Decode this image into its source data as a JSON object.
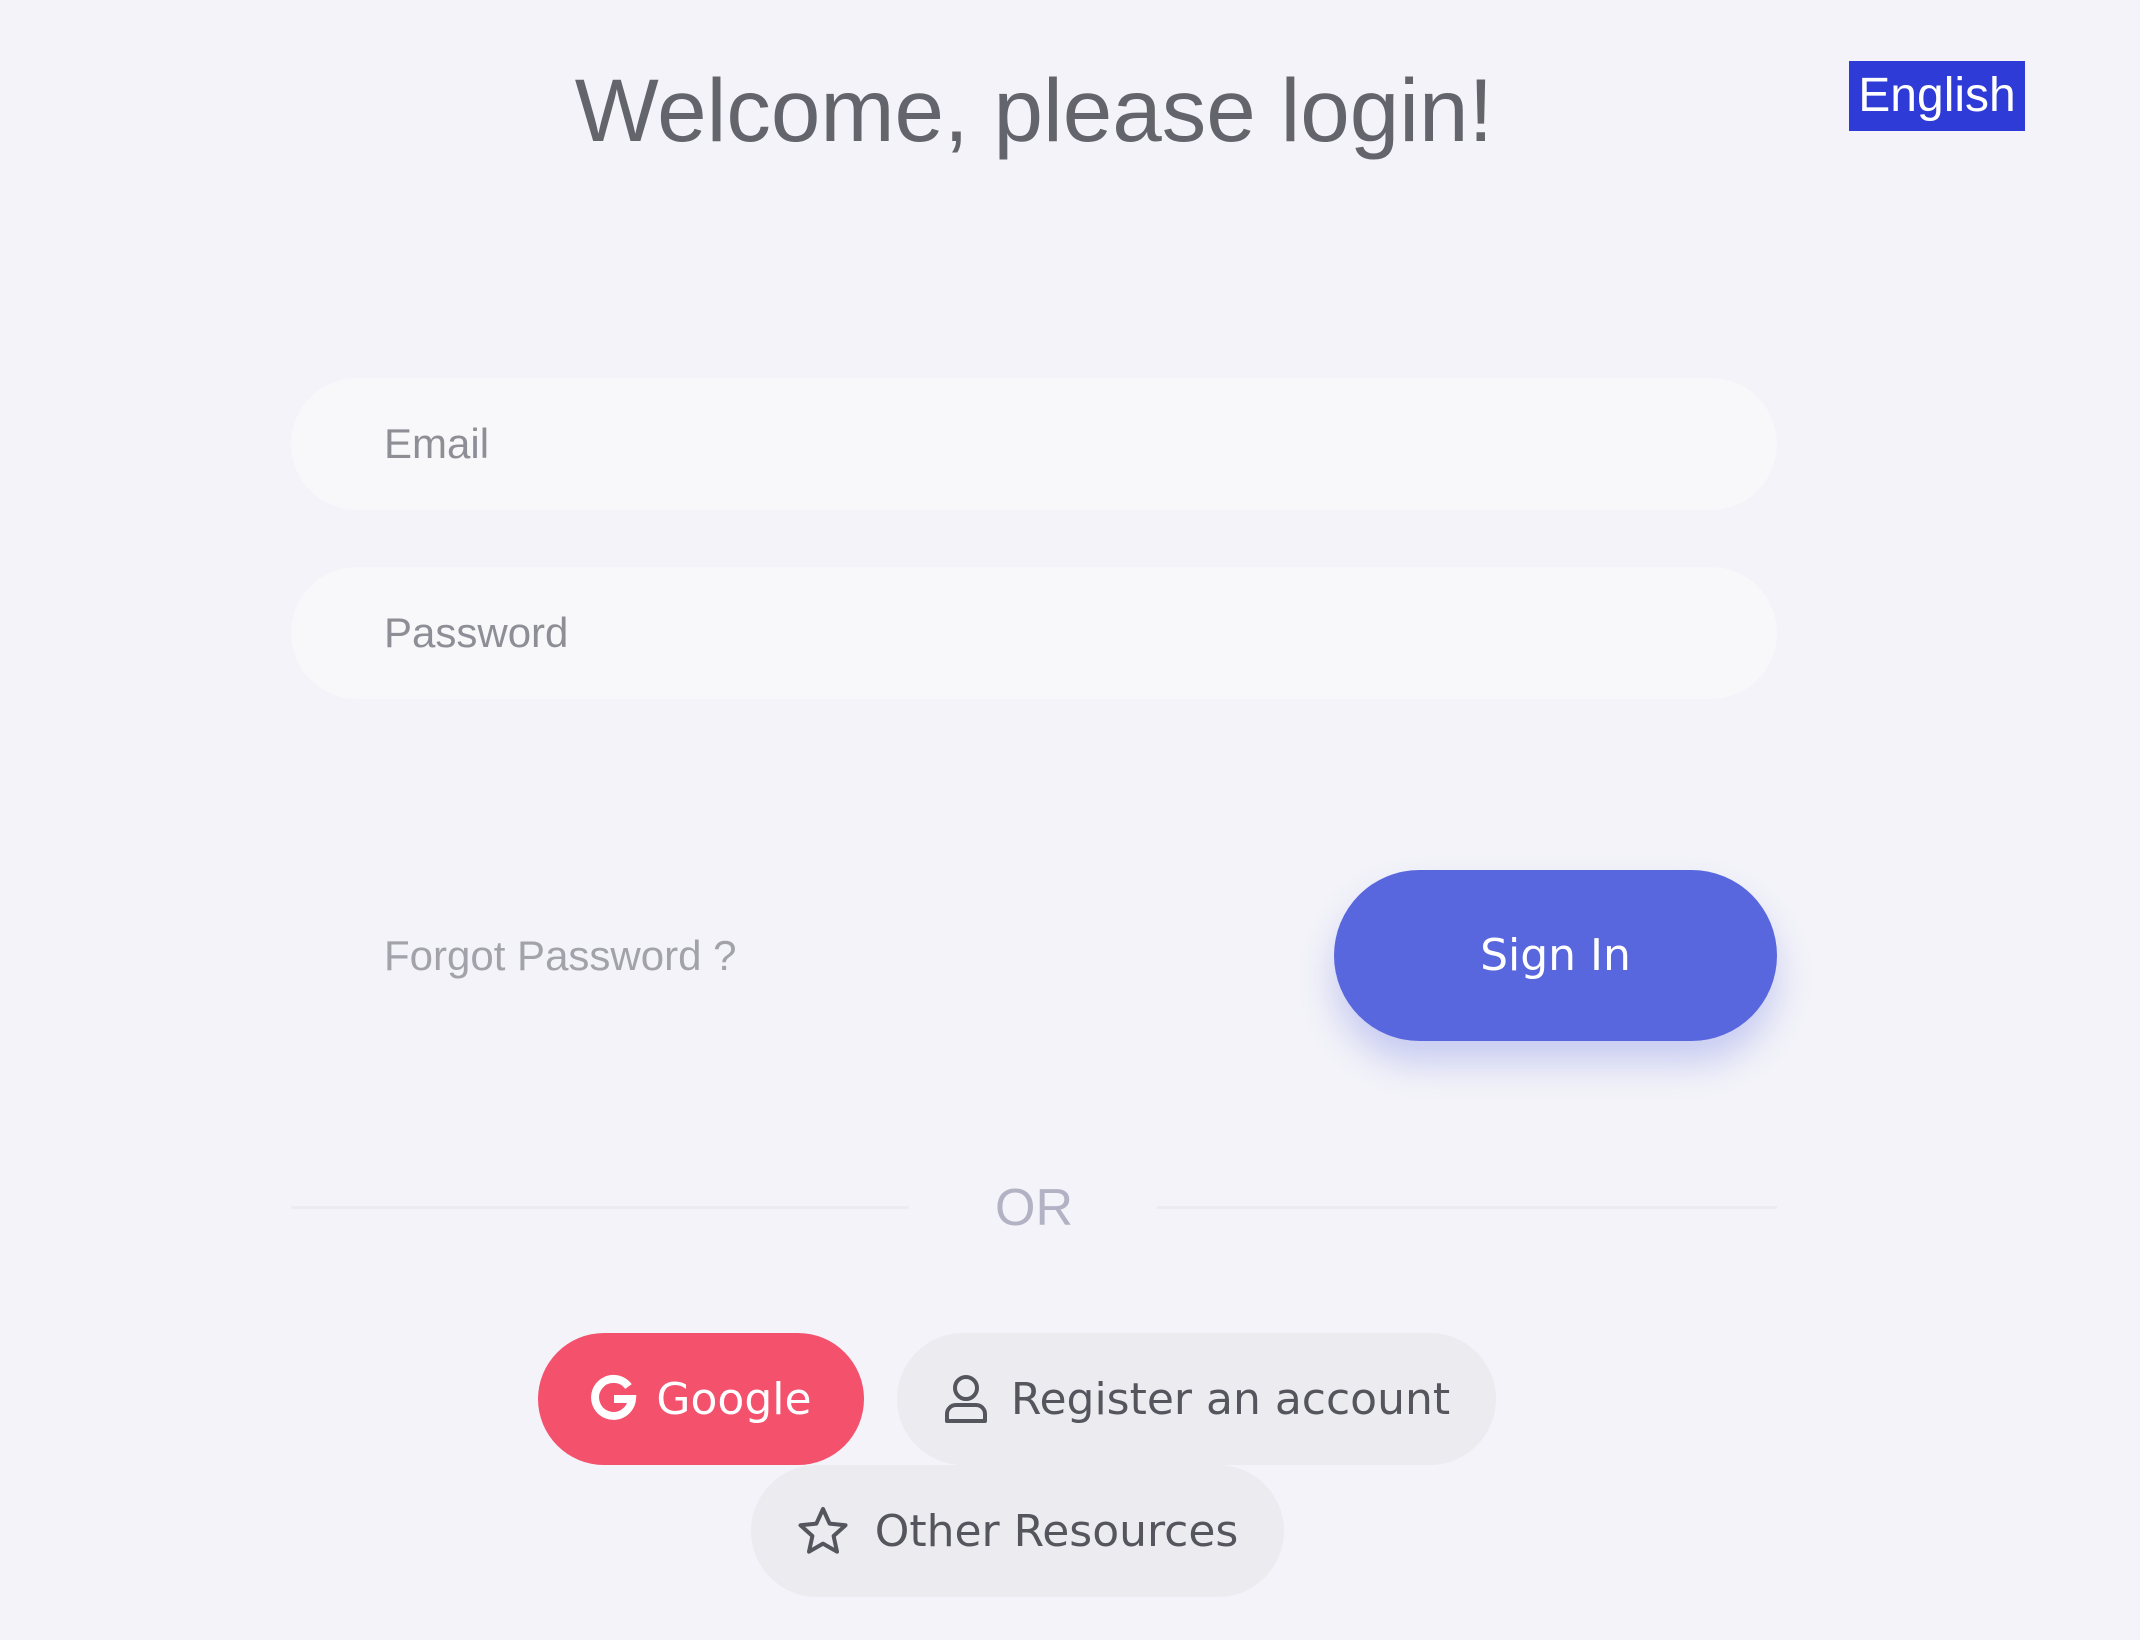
{
  "header": {
    "title": "Welcome, please login!",
    "language": "English"
  },
  "form": {
    "email_placeholder": "Email",
    "email_value": "",
    "password_placeholder": "Password",
    "password_value": "",
    "forgot_password": "Forgot Password ?",
    "sign_in": "Sign In"
  },
  "divider": {
    "label": "OR"
  },
  "alternatives": {
    "google": {
      "label": "Google",
      "icon": "google-icon"
    },
    "register": {
      "label": "Register an account",
      "icon": "user-icon"
    },
    "other_resources": {
      "label": "Other Resources",
      "icon": "star-icon"
    }
  },
  "colors": {
    "background": "#f3f3f9",
    "accent": "#5867dd",
    "google": "#f4516c",
    "language_badge": "#2e3bd6"
  }
}
